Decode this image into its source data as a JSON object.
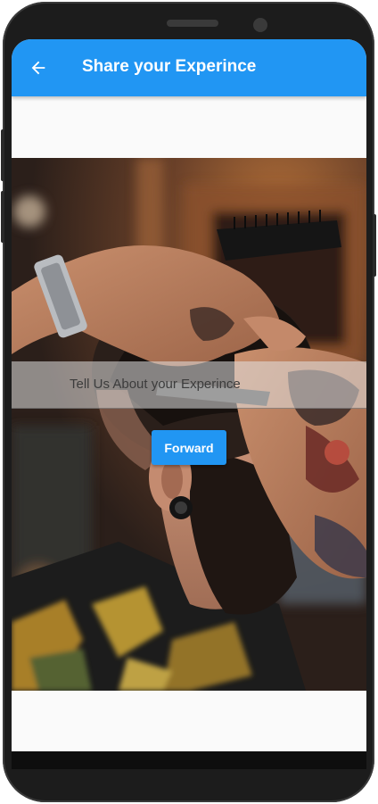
{
  "app": {
    "title": "Share your Experince"
  },
  "appbar": {
    "back_icon": "arrow-back-icon",
    "color": "#2196f3"
  },
  "photo": {
    "subject": "barber-haircut-photo"
  },
  "prompt": {
    "text": "Tell Us About your Experince"
  },
  "actions": {
    "forward_label": "Forward",
    "forward_color": "#2196f3"
  }
}
